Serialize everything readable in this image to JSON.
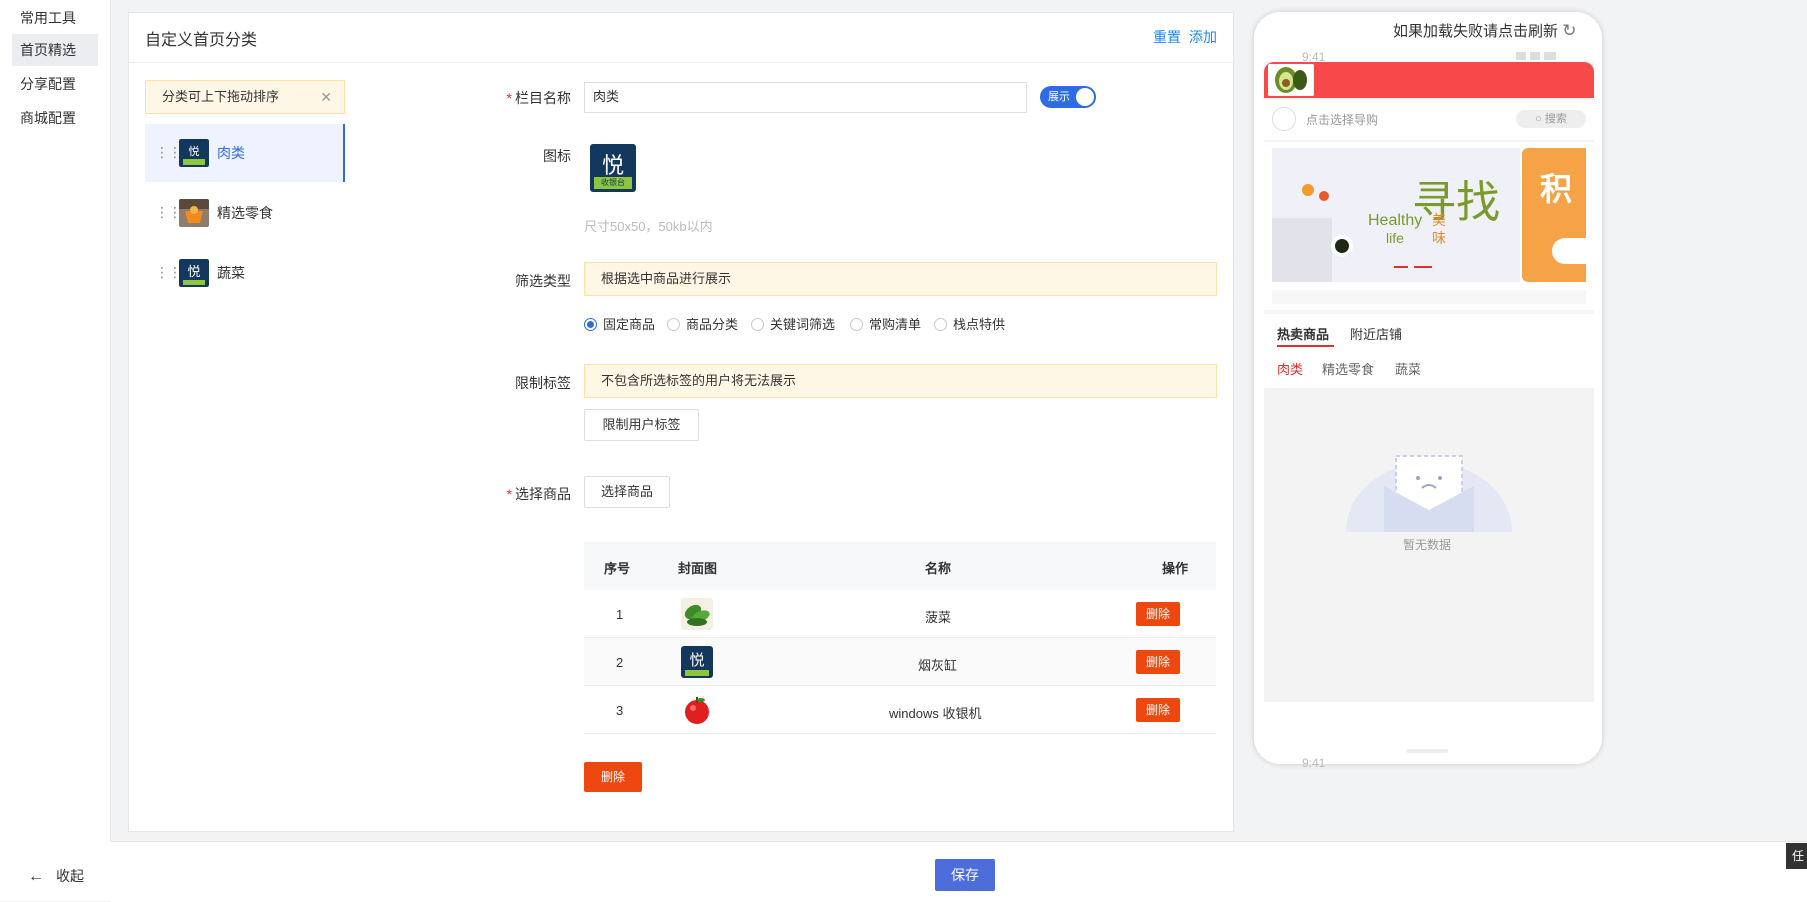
{
  "nav": {
    "items": [
      {
        "label": "常用工具"
      },
      {
        "label": "首页精选"
      },
      {
        "label": "分享配置"
      },
      {
        "label": "商城配置"
      }
    ],
    "collapse_label": "收起"
  },
  "card": {
    "title": "自定义首页分类",
    "reset_label": "重置",
    "add_label": "添加"
  },
  "categories": {
    "drag_tip": "分类可上下拖动排序",
    "items": [
      {
        "name": "肉类"
      },
      {
        "name": "精选零食"
      },
      {
        "name": "蔬菜"
      }
    ]
  },
  "form": {
    "column_name_label": "栏目名称",
    "column_name_value": "肉类",
    "show_toggle_label": "展示",
    "icon_label": "图标",
    "icon_brand": "悦",
    "icon_caption": "收银台",
    "size_hint": "尺寸50x50，50kb以内",
    "filter_type_label": "筛选类型",
    "filter_notice": "根据选中商品进行展示",
    "filter_options": [
      "固定商品",
      "商品分类",
      "关键词筛选",
      "常购清单",
      "栈点特供"
    ],
    "limit_tag_label": "限制标签",
    "limit_notice": "不包含所选标签的用户将无法展示",
    "limit_button": "限制用户标签",
    "select_goods_label": "选择商品",
    "select_goods_button": "选择商品"
  },
  "table": {
    "headers": {
      "index": "序号",
      "cover": "封面图",
      "name": "名称",
      "action": "操作"
    },
    "rows": [
      {
        "index": "1",
        "name": "菠菜",
        "action": "删除",
        "cover_icon": "spinach-icon"
      },
      {
        "index": "2",
        "name": "烟灰缸",
        "action": "删除",
        "cover_icon": "brand-logo-icon"
      },
      {
        "index": "3",
        "name": "windows 收银机",
        "action": "删除",
        "cover_icon": "apple-icon"
      }
    ],
    "bulk_delete": "删除"
  },
  "preview": {
    "reload_tip": "如果加载失败请点击刷新",
    "status_time": "9:41",
    "guide_placeholder": "点击选择导购",
    "search_label": "搜索",
    "banner_text_big": "寻找",
    "banner_text_en1": "Healthy",
    "banner_text_en2": "life",
    "banner_text_cn1": "美",
    "banner_text_cn2": "味",
    "banner_side_text": "积",
    "tabs": [
      "热卖商品",
      "附近店铺"
    ],
    "sub_tabs": [
      "肉类",
      "精选零食",
      "蔬菜"
    ],
    "empty_text": "暂无数据"
  },
  "footer": {
    "save_label": "保存",
    "corner_tag": "任"
  },
  "colors": {
    "primary": "#2f6be5",
    "danger": "#ee4810",
    "notice_bg": "#fff7e6",
    "preview_header": "#f7484a",
    "save_button": "#4c6ddb"
  }
}
